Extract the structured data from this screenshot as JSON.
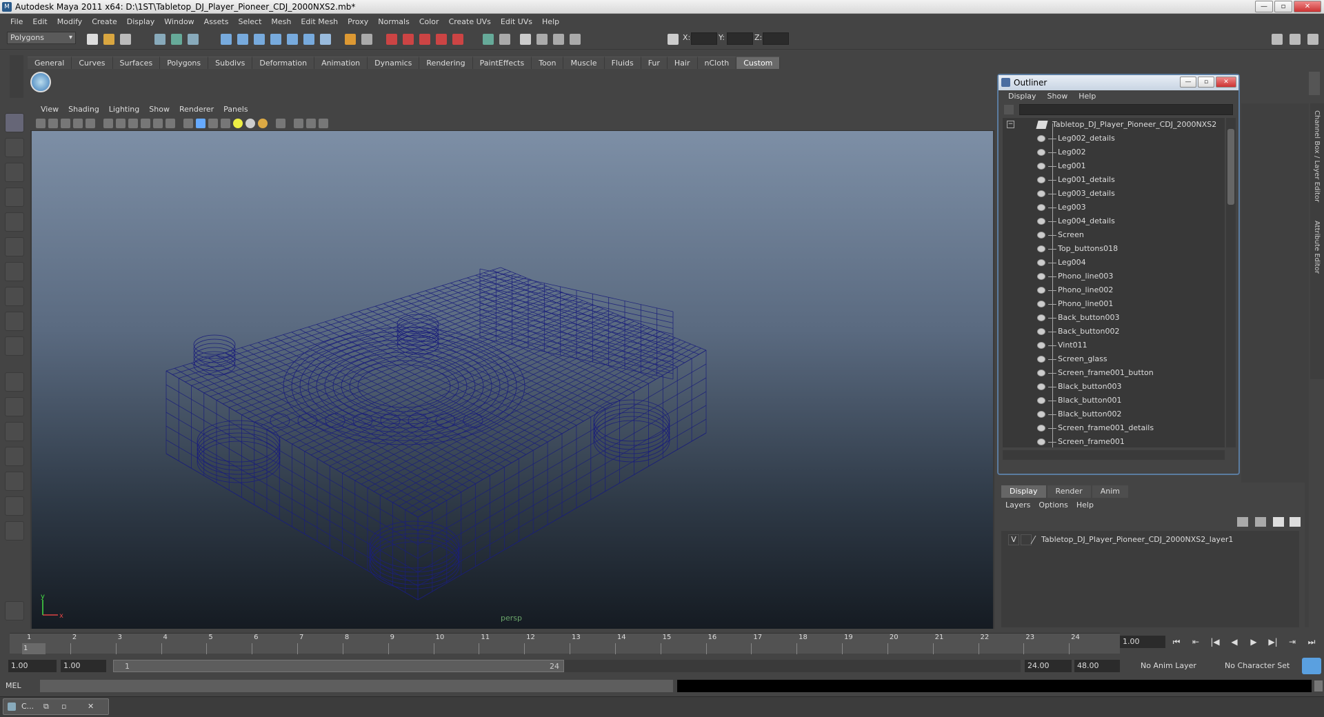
{
  "window": {
    "title": "Autodesk Maya 2011 x64: D:\\1ST\\Tabletop_DJ_Player_Pioneer_CDJ_2000NXS2.mb*"
  },
  "menus": [
    "File",
    "Edit",
    "Modify",
    "Create",
    "Display",
    "Window",
    "Assets",
    "Select",
    "Mesh",
    "Edit Mesh",
    "Proxy",
    "Normals",
    "Color",
    "Create UVs",
    "Edit UVs",
    "Help"
  ],
  "toolbar": {
    "mode": "Polygons",
    "x_label": "X:",
    "y_label": "Y:",
    "z_label": "Z:"
  },
  "shelf_tabs": [
    "General",
    "Curves",
    "Surfaces",
    "Polygons",
    "Subdivs",
    "Deformation",
    "Animation",
    "Dynamics",
    "Rendering",
    "PaintEffects",
    "Toon",
    "Muscle",
    "Fluids",
    "Fur",
    "Hair",
    "nCloth",
    "Custom"
  ],
  "viewport": {
    "menus": [
      "View",
      "Shading",
      "Lighting",
      "Show",
      "Renderer",
      "Panels"
    ],
    "camera": "persp",
    "axis_x": "x",
    "axis_y": "y",
    "wire_color": "#1b1f7a"
  },
  "outliner": {
    "title": "Outliner",
    "menus": [
      "Display",
      "Show",
      "Help"
    ],
    "root": "Tabletop_DJ_Player_Pioneer_CDJ_2000NXS2",
    "items": [
      "Leg002_details",
      "Leg002",
      "Leg001",
      "Leg001_details",
      "Leg003_details",
      "Leg003",
      "Leg004_details",
      "Screen",
      "Top_buttons018",
      "Leg004",
      "Phono_line003",
      "Phono_line002",
      "Phono_line001",
      "Back_button003",
      "Back_button002",
      "Vint011",
      "Screen_glass",
      "Screen_frame001_button",
      "Black_button003",
      "Black_button001",
      "Black_button002",
      "Screen_frame001_details",
      "Screen_frame001"
    ]
  },
  "layers": {
    "tabs": [
      "Display",
      "Render",
      "Anim"
    ],
    "menus": [
      "Layers",
      "Options",
      "Help"
    ],
    "visible_flag": "V",
    "layer_name": "Tabletop_DJ_Player_Pioneer_CDJ_2000NXS2_layer1"
  },
  "side_strip": {
    "channel_box": "Channel Box / Layer Editor",
    "attr_editor": "Attribute Editor"
  },
  "timeline": {
    "ticks": [
      "1",
      "2",
      "3",
      "4",
      "5",
      "6",
      "7",
      "8",
      "9",
      "10",
      "11",
      "12",
      "13",
      "14",
      "15",
      "16",
      "17",
      "18",
      "19",
      "20",
      "21",
      "22",
      "23",
      "24"
    ],
    "current_frame": "1.00",
    "playhead": "1"
  },
  "range": {
    "start": "1.00",
    "anim_start": "1.00",
    "slider_start": "1",
    "slider_end": "24",
    "range_end": "24.00",
    "anim_end": "48.00",
    "anim_layer": "No Anim Layer",
    "character_set": "No Character Set"
  },
  "command": {
    "label": "MEL"
  },
  "taskbar": {
    "label": "C..."
  }
}
